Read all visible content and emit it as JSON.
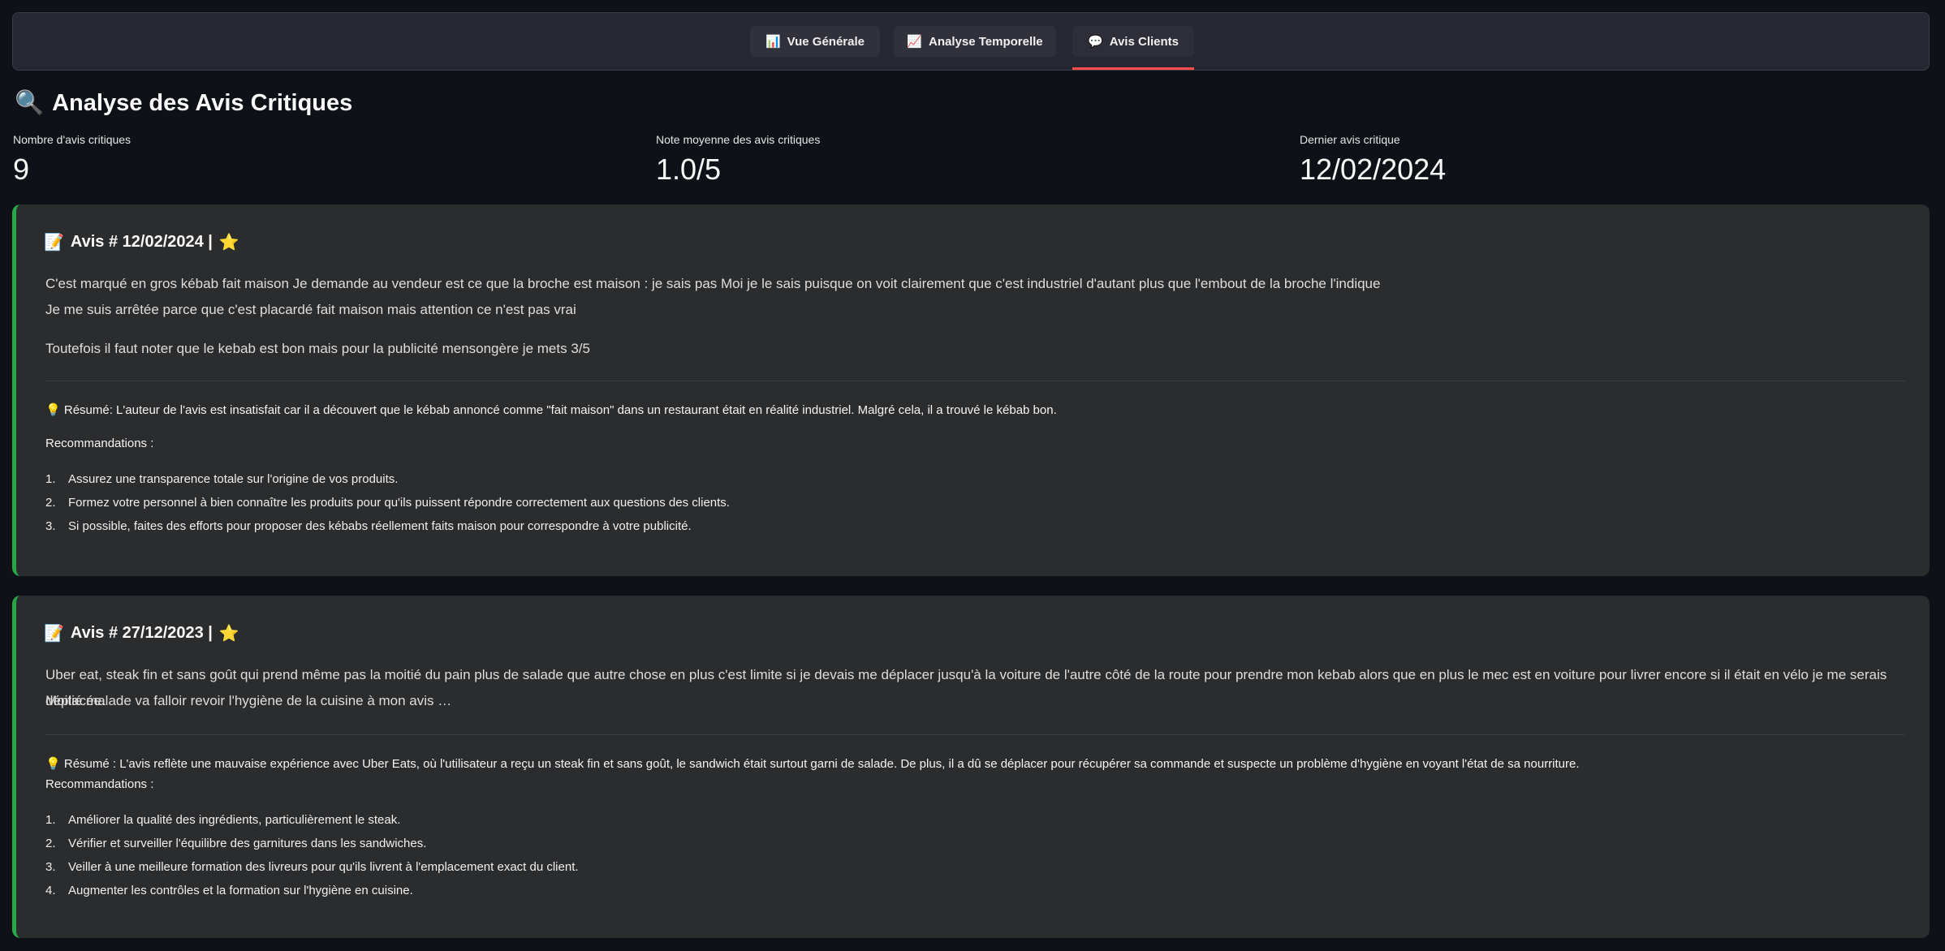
{
  "tabs": [
    {
      "icon": "📊",
      "label": "Vue Générale"
    },
    {
      "icon": "📈",
      "label": "Analyse Temporelle"
    },
    {
      "icon": "💬",
      "label": "Avis Clients"
    }
  ],
  "page": {
    "icon": "🔍",
    "title": "Analyse des Avis Critiques"
  },
  "metrics": [
    {
      "label": "Nombre d'avis critiques",
      "value": "9"
    },
    {
      "label": "Note moyenne des avis critiques",
      "value": "1.0/5"
    },
    {
      "label": "Dernier avis critique",
      "value": "12/02/2024"
    }
  ],
  "reviews": [
    {
      "title": "Avis # 12/02/2024 |",
      "title_icon": "📝",
      "star": "⭐",
      "lines": [
        "C'est marqué en gros kébab fait maison Je demande au vendeur est ce que la broche est maison : je sais pas Moi je le sais puisque on voit clairement que c'est industriel d'autant plus que l'embout de la broche l'indique",
        "Je me suis arrêtée parce que c'est placardé fait maison mais attention ce n'est pas vrai",
        "Toutefois il faut noter que le kebab est bon mais pour la publicité mensongère je mets 3/5"
      ],
      "summary_icon": "💡",
      "summary": "Résumé: L'auteur de l'avis est insatisfait car il a découvert que le kébab annoncé comme \"fait maison\" dans un restaurant était en réalité industriel. Malgré cela, il a trouvé le kébab bon.",
      "recs_label": "Recommandations :",
      "recs": [
        "Assurez une transparence totale sur l'origine de vos produits.",
        "Formez votre personnel à bien connaître les produits pour qu'ils puissent répondre correctement aux questions des clients.",
        "Si possible, faites des efforts pour proposer des kébabs réellement faits maison pour correspondre à votre publicité."
      ]
    },
    {
      "title": "Avis # 27/12/2023 |",
      "title_icon": "📝",
      "star": "⭐",
      "lines": [
        "Uber eat, steak fin et sans goût qui prend même pas la moitié du pain plus de salade que autre chose en plus c'est limite si je devais me déplacer jusqu'à la voiture de l'autre côté de la route pour prendre mon kebab alors que en plus le mec est en voiture pour livrer encore si il était en vélo je me serais déplacée.",
        "Moitié malade va falloir revoir l'hygiène de la cuisine à mon avis …"
      ],
      "summary_icon": "💡",
      "summary": "Résumé : L'avis reflète une mauvaise expérience avec Uber Eats, où l'utilisateur a reçu un steak fin et sans goût, le sandwich était surtout garni de salade. De plus, il a dû se déplacer pour récupérer sa commande et suspecte un problème d'hygiène en voyant l'état de sa nourriture.",
      "recs_label": "Recommandations :",
      "recs": [
        "Améliorer la qualité des ingrédients, particulièrement le steak.",
        "Vérifier et surveiller l'équilibre des garnitures dans les sandwiches.",
        "Veiller à une meilleure formation des livreurs pour qu'ils livrent à l'emplacement exact du client.",
        "Augmenter les contrôles et la formation sur l'hygiène en cuisine."
      ]
    }
  ],
  "colors": {
    "background": "#0e1117",
    "card": "#2b2c2e",
    "accent_border": "#28a745",
    "active_tab": "#ff4b4b"
  }
}
